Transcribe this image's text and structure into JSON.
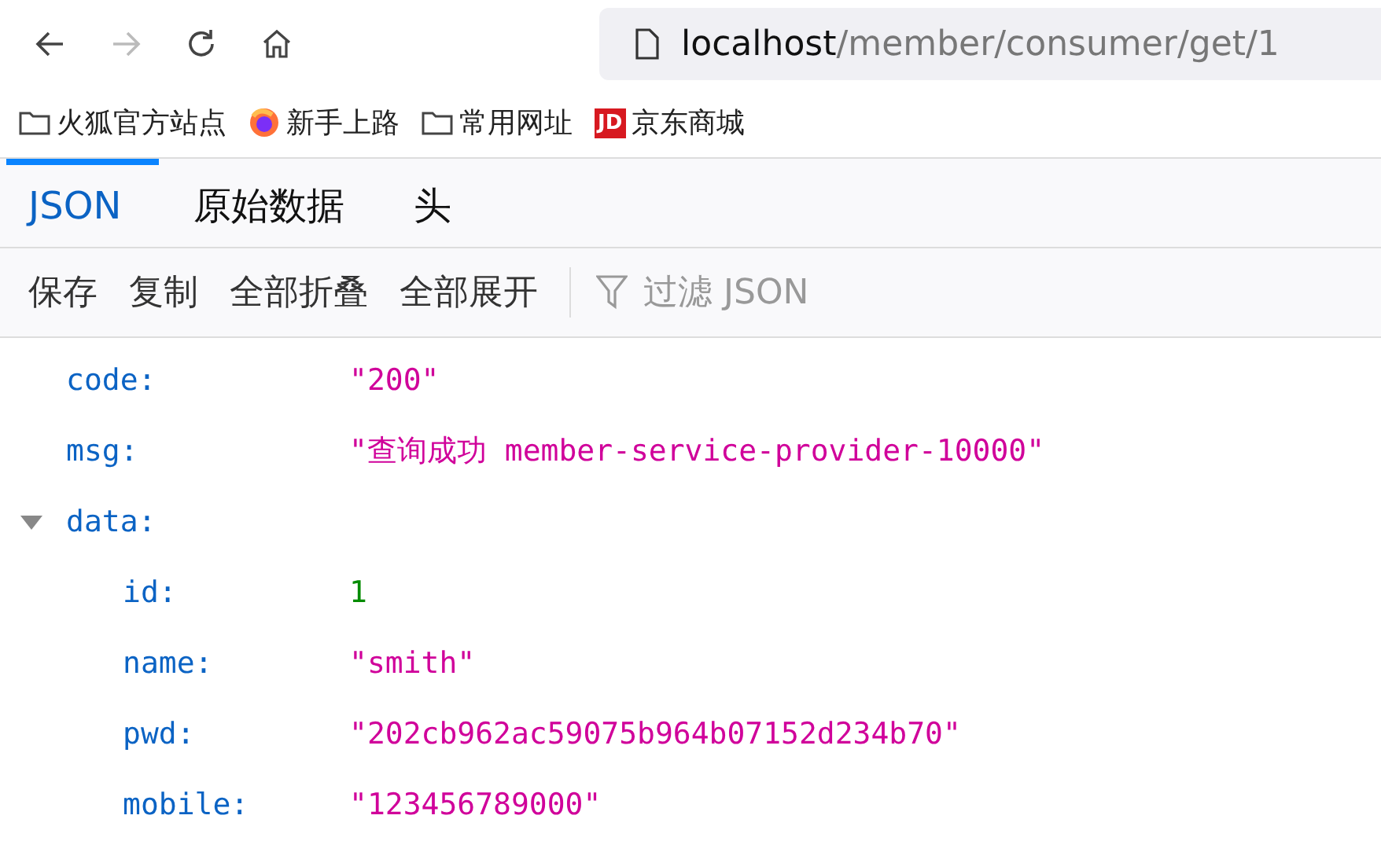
{
  "address_bar": {
    "host": "localhost",
    "path": "/member/consumer/get/1"
  },
  "bookmarks": [
    {
      "label": "火狐官方站点",
      "kind": "folder"
    },
    {
      "label": "新手上路",
      "kind": "firefox"
    },
    {
      "label": "常用网址",
      "kind": "folder"
    },
    {
      "label": "京东商城",
      "kind": "jd",
      "icon_text": "JD"
    }
  ],
  "tabs": [
    {
      "label": "JSON",
      "selected": true
    },
    {
      "label": "原始数据",
      "selected": false
    },
    {
      "label": "头",
      "selected": false
    }
  ],
  "actions": [
    "保存",
    "复制",
    "全部折叠",
    "全部展开"
  ],
  "filter": {
    "placeholder": "过滤 JSON"
  },
  "rows": [
    {
      "key": "code:",
      "value": "\"200\"",
      "kind": "string"
    },
    {
      "key": "msg:",
      "value": "\"查询成功 member-service-provider-10000\"",
      "kind": "string"
    },
    {
      "key": "data:",
      "kind": "object",
      "expanded": true,
      "children": [
        {
          "key": "id:",
          "value": "1",
          "kind": "number"
        },
        {
          "key": "name:",
          "value": "\"smith\"",
          "kind": "string"
        },
        {
          "key": "pwd:",
          "value": "\"202cb962ac59075b964b07152d234b70\"",
          "kind": "string"
        },
        {
          "key": "mobile:",
          "value": "\"123456789000\"",
          "kind": "string"
        }
      ]
    }
  ]
}
